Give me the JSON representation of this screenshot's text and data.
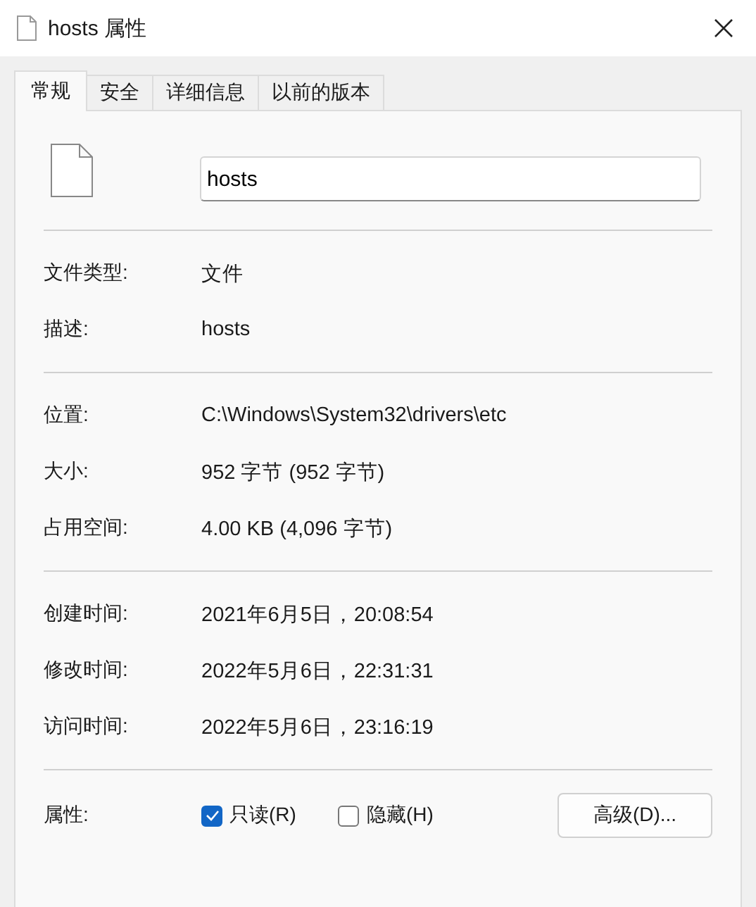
{
  "window": {
    "title": "hosts 属性"
  },
  "tabs": [
    {
      "label": "常规",
      "selected": true
    },
    {
      "label": "安全",
      "selected": false
    },
    {
      "label": "详细信息",
      "selected": false
    },
    {
      "label": "以前的版本",
      "selected": false
    }
  ],
  "file_name": {
    "value": "hosts"
  },
  "sections": [
    [
      {
        "label": "文件类型:",
        "value": "文件"
      },
      {
        "label": "描述:",
        "value": "hosts"
      }
    ],
    [
      {
        "label": "位置:",
        "value": "C:\\Windows\\System32\\drivers\\etc"
      },
      {
        "label": "大小:",
        "value": "952 字节 (952 字节)"
      },
      {
        "label": "占用空间:",
        "value": "4.00 KB (4,096 字节)"
      }
    ],
    [
      {
        "label": "创建时间:",
        "value": "2021年6月5日，20:08:54"
      },
      {
        "label": "修改时间:",
        "value": "2022年5月6日，22:31:31"
      },
      {
        "label": "访问时间:",
        "value": "2022年5月6日，23:16:19"
      }
    ]
  ],
  "attributes": {
    "label": "属性:",
    "options": [
      {
        "label": "只读(R)",
        "checked": true
      },
      {
        "label": "隐藏(H)",
        "checked": false
      }
    ],
    "advanced_button": "高级(D)..."
  }
}
